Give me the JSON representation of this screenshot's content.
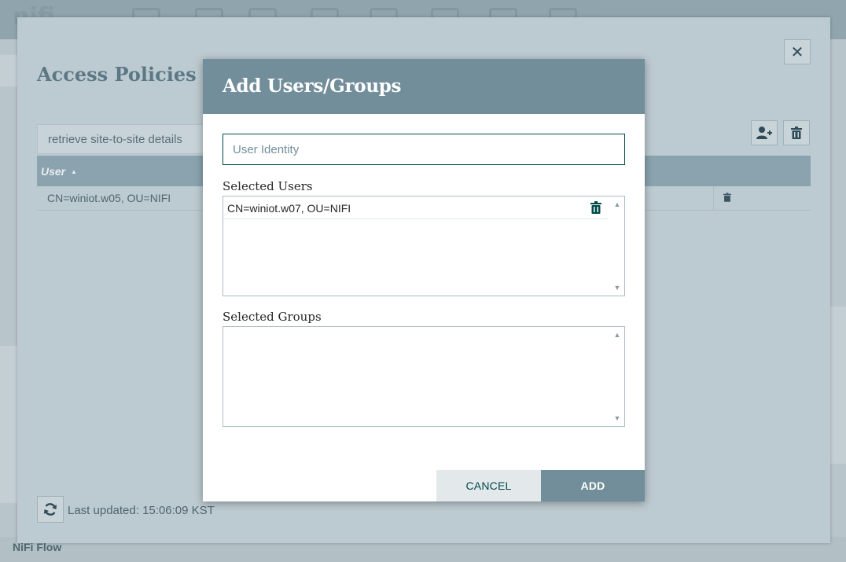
{
  "app": {
    "breadcrumb": "NiFi Flow"
  },
  "access_policies": {
    "title": "Access Policies",
    "policy_select": "retrieve site-to-site details",
    "table": {
      "columns": [
        "User"
      ],
      "sort_indicator": "▲",
      "rows": [
        {
          "user": "CN=winiot.w05, OU=NIFI"
        }
      ]
    },
    "last_updated_label": "Last updated:",
    "last_updated_value": "15:06:09 KST"
  },
  "modal": {
    "title": "Add Users/Groups",
    "identity_placeholder": "User Identity",
    "selected_users_label": "Selected Users",
    "selected_users": [
      "CN=winiot.w07, OU=NIFI"
    ],
    "selected_groups_label": "Selected Groups",
    "selected_groups": [],
    "cancel_label": "CANCEL",
    "add_label": "ADD"
  },
  "colors": {
    "header": "#728e9b",
    "button_text_dark": "#004849",
    "cancel_bg": "#e3e8eb"
  },
  "icons": [
    "close-icon",
    "add-user-icon",
    "trash-icon",
    "refresh-icon",
    "sort-up-icon",
    "scroll-up-icon",
    "scroll-down-icon"
  ]
}
